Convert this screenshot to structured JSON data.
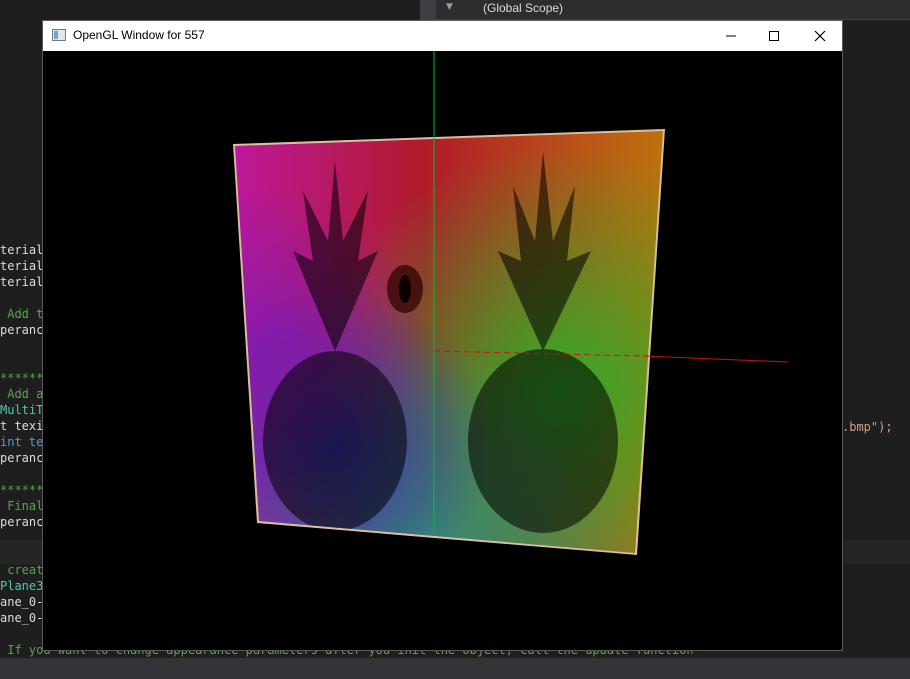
{
  "ide": {
    "scope_dropdown": "(Global Scope)",
    "code_lines": [
      {
        "text": "terial",
        "cls": ""
      },
      {
        "text": "terial",
        "cls": ""
      },
      {
        "text": "terial",
        "cls": ""
      },
      {
        "text": "",
        "cls": ""
      },
      {
        "text": " Add t",
        "cls": "c-comment"
      },
      {
        "text": "peranc",
        "cls": ""
      },
      {
        "text": "",
        "cls": ""
      },
      {
        "text": "",
        "cls": ""
      },
      {
        "text": "******",
        "cls": "c-comment"
      },
      {
        "text": " Add a",
        "cls": "c-comment"
      },
      {
        "text": "MultiT",
        "cls": "c-type"
      },
      {
        "text": "t texi",
        "cls": ""
      },
      {
        "text": "int te",
        "cls": "c-kw"
      },
      {
        "text": "peranc",
        "cls": ""
      },
      {
        "text": "",
        "cls": ""
      },
      {
        "text": "******",
        "cls": "c-comment"
      },
      {
        "text": " Final",
        "cls": "c-comment"
      },
      {
        "text": "peranc",
        "cls": ""
      }
    ],
    "code_lines_2": [
      {
        "text": " creat",
        "cls": "c-comment"
      },
      {
        "text": "Plane3",
        "cls": "c-type"
      },
      {
        "text": "ane_0-",
        "cls": ""
      },
      {
        "text": "ane_0-",
        "cls": ""
      }
    ],
    "right_code": ".bmp\");",
    "bottom_comment": " If you want to change appearance parameters after you init the object, call the update function"
  },
  "window": {
    "title": "OpenGL Window for 557",
    "minimize_label": "minimize",
    "maximize_label": "maximize",
    "close_label": "close"
  },
  "scene": {
    "background": "#000000",
    "y_axis_color": "#00cc33",
    "x_axis_color": "#cc1111",
    "gradient_colors": [
      "#e020c0",
      "#e02040",
      "#e08010",
      "#30c030",
      "#20a0a0",
      "#4030c0"
    ]
  }
}
